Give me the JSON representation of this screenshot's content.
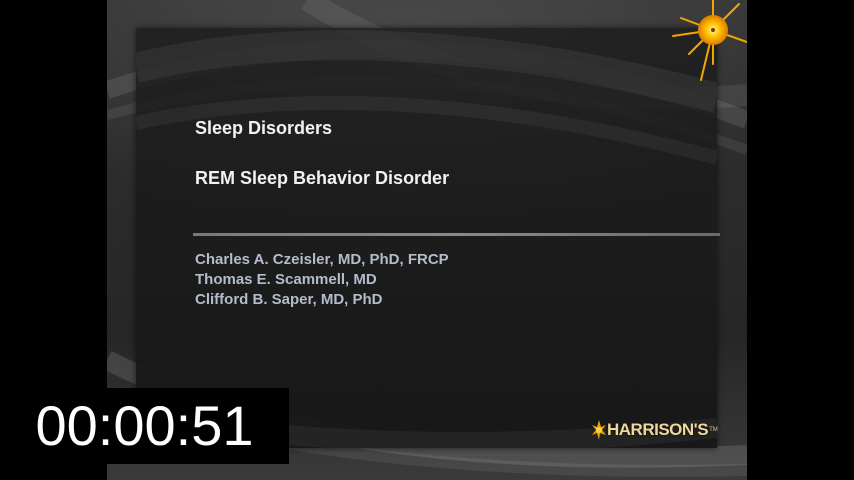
{
  "slide": {
    "title": "Sleep Disorders",
    "subtitle": "REM Sleep Behavior Disorder",
    "authors": [
      "Charles A. Czeisler, MD, PhD, FRCP",
      "Thomas E. Scammell, MD",
      "Clifford B. Saper, MD, PhD"
    ],
    "logo_text": "HARRISON'S",
    "logo_tm": "TM"
  },
  "overlay": {
    "timer": "00:00:51"
  },
  "colors": {
    "background": "#000000",
    "slide_bg": "#2c2c2c",
    "title_text": "#f2f2f2",
    "author_text": "#b4bccb",
    "logo_text": "#f0d79a",
    "sun": "#f5b400"
  },
  "icons": {
    "sun": "sun-icon",
    "logo_flame": "flame-icon"
  }
}
